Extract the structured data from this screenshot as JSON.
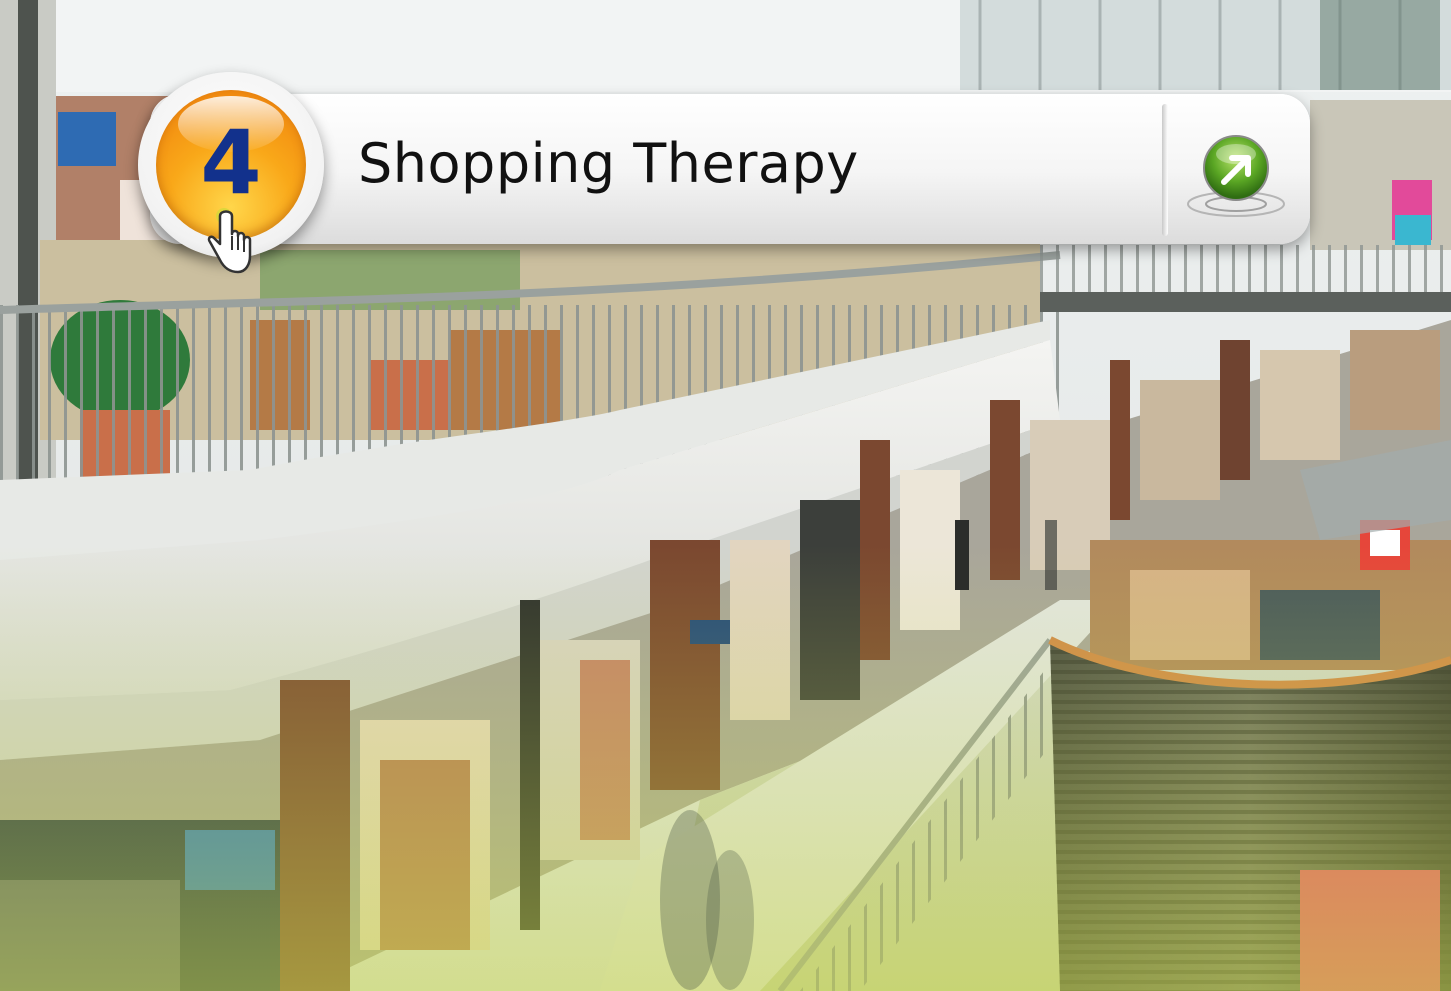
{
  "topic": {
    "number": "4",
    "title": "Shopping Therapy"
  },
  "icons": {
    "go_button": "arrow-up-right-icon",
    "cursor": "hand-pointer-icon",
    "background": "shopping-mall-photo"
  },
  "colors": {
    "badge_orange": "#f39a12",
    "badge_number": "#12318c",
    "go_green": "#5aa624",
    "bar_white": "#f5f5f5"
  }
}
